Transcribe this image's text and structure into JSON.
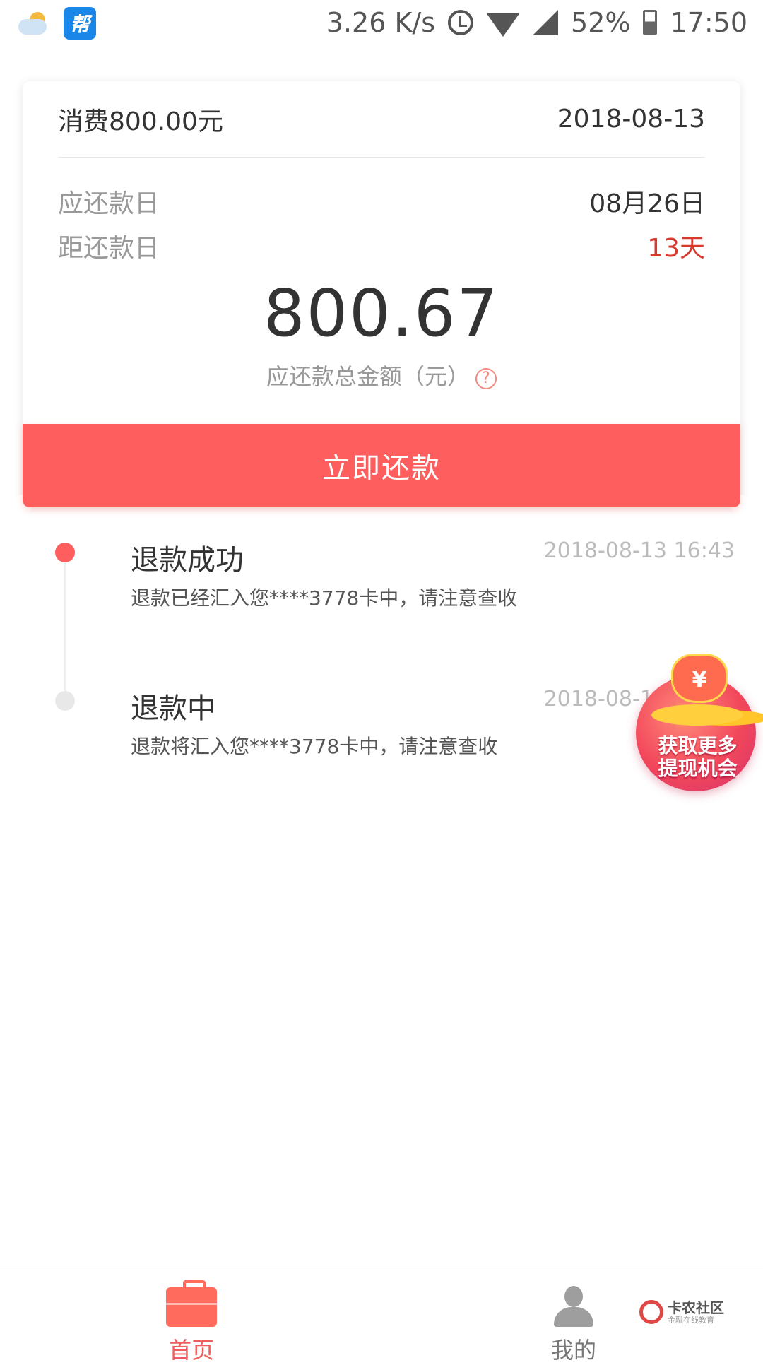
{
  "status_bar": {
    "network_speed": "3.26 K/s",
    "battery": "52%",
    "time": "17:50",
    "app_icon_char": "帮"
  },
  "bill": {
    "consumption": "消费800.00元",
    "date": "2018-08-13",
    "due_label": "应还款日",
    "due_value": "08月26日",
    "days_label": "距还款日",
    "days_value": "13天",
    "amount": "800.67",
    "amount_label": "应还款总金额（元）",
    "help_symbol": "?"
  },
  "repay_button": "立即还款",
  "timeline": [
    {
      "title": "退款成功",
      "time": "2018-08-13 16:43",
      "desc": "退款已经汇入您****3778卡中，请注意查收"
    },
    {
      "title": "退款中",
      "time": "2018-08-13 16:43",
      "desc": "退款将汇入您****3778卡中，请注意查收"
    }
  ],
  "promo": {
    "coin_symbol": "¥",
    "line1": "获取更多",
    "line2": "提现机会"
  },
  "nav": {
    "home": "首页",
    "mine": "我的"
  },
  "watermark": {
    "title": "卡农社区",
    "subtitle": "金融在线教育"
  },
  "colors": {
    "accent": "#ff5e5e",
    "due_red": "#d63a2f"
  }
}
